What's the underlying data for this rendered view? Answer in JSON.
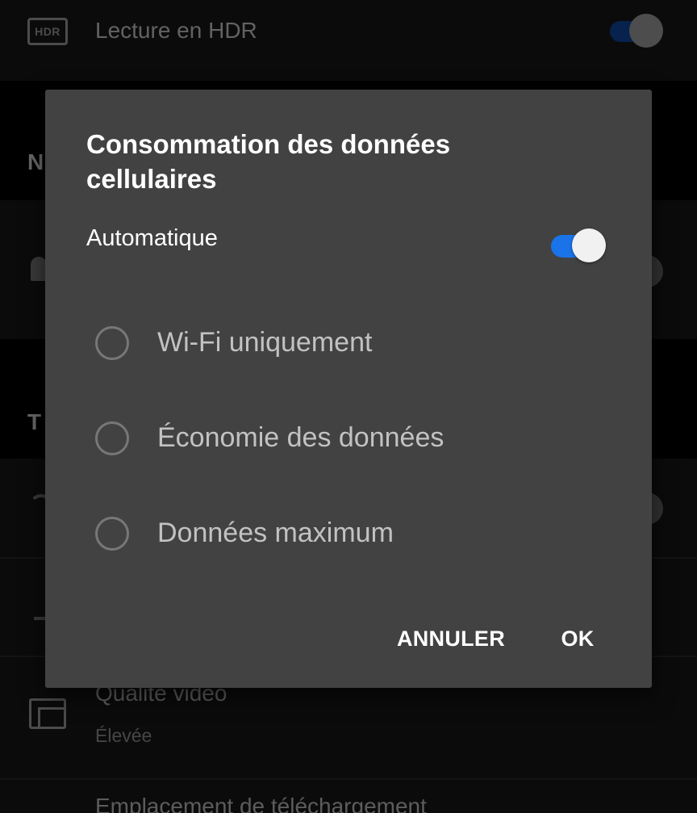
{
  "background": {
    "hdr": {
      "badge": "HDR",
      "label": "Lecture en HDR"
    },
    "section_n": "N",
    "section_t": "T",
    "video_quality": {
      "label": "Qualité vidéo",
      "value": "Élevée"
    },
    "download_location": {
      "label": "Emplacement de téléchargement"
    },
    "icons": [
      "hdr-icon",
      "bell-icon",
      "wifi-icon",
      "download-icon",
      "video-quality-icon"
    ]
  },
  "dialog": {
    "title": "Consommation des données cellulaires",
    "automatic": {
      "label": "Automatique",
      "on": true
    },
    "options": [
      {
        "label": "Wi-Fi uniquement",
        "selected": false
      },
      {
        "label": "Économie des données",
        "selected": false
      },
      {
        "label": "Données maximum",
        "selected": false
      }
    ],
    "buttons": {
      "cancel": "ANNULER",
      "ok": "OK"
    }
  },
  "colors": {
    "dialog_bg": "#424242",
    "accent": "#1a73e8",
    "page_bg": "#000000"
  }
}
